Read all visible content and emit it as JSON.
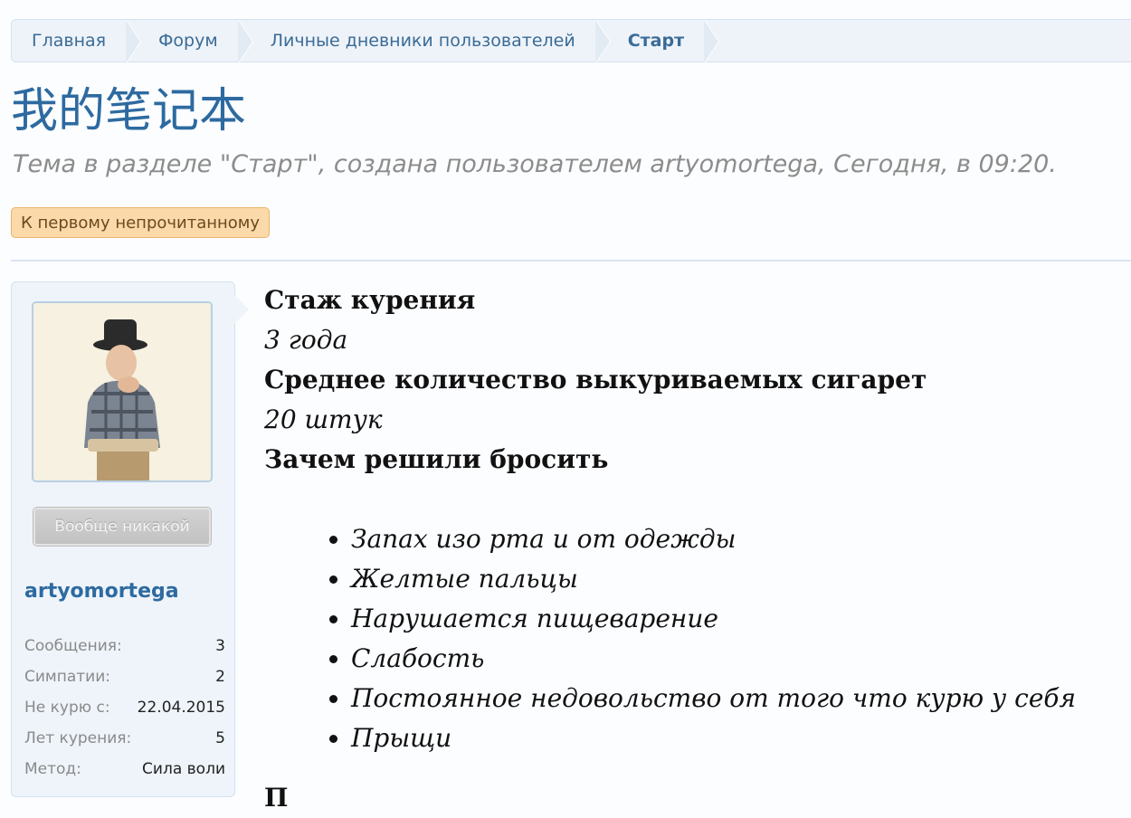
{
  "breadcrumb": {
    "items": [
      "Главная",
      "Форум",
      "Личные дневники пользователей",
      "Старт"
    ]
  },
  "thread": {
    "title": "我的笔记本",
    "meta": "Тема в разделе \"Старт\", создана пользователем artyomortega, Сегодня, в 09:20.",
    "unread_button": "К первому непрочитанному"
  },
  "author": {
    "rank": "Вообще никакой",
    "username": "artyomortega",
    "stats": [
      {
        "label": "Сообщения:",
        "value": "3"
      },
      {
        "label": "Симпатии:",
        "value": "2"
      },
      {
        "label": "Не курю с:",
        "value": "22.04.2015"
      },
      {
        "label": "Лет курения:",
        "value": "5"
      },
      {
        "label": "Метод:",
        "value": "Сила воли"
      }
    ]
  },
  "post": {
    "smoking_exp_label": "Стаж курения",
    "smoking_exp_value": "3 года",
    "avg_cigs_label": "Среднее количество выкуриваемых сигарет",
    "avg_cigs_value": "20 штук",
    "why_quit_label": "Зачем решили бросить",
    "reasons": [
      "Запах изо рта и от одежды",
      "Желтые пальцы",
      "Нарушается пищеварение",
      "Слабость",
      "Постоянное недовольство от того что курю у себя",
      "Прыщи"
    ],
    "next_label_partial": "П"
  },
  "colors": {
    "link": "#2d6aa0",
    "unread_bg": "#fbd9a8",
    "sidebar_bg": "#eef4fa"
  }
}
